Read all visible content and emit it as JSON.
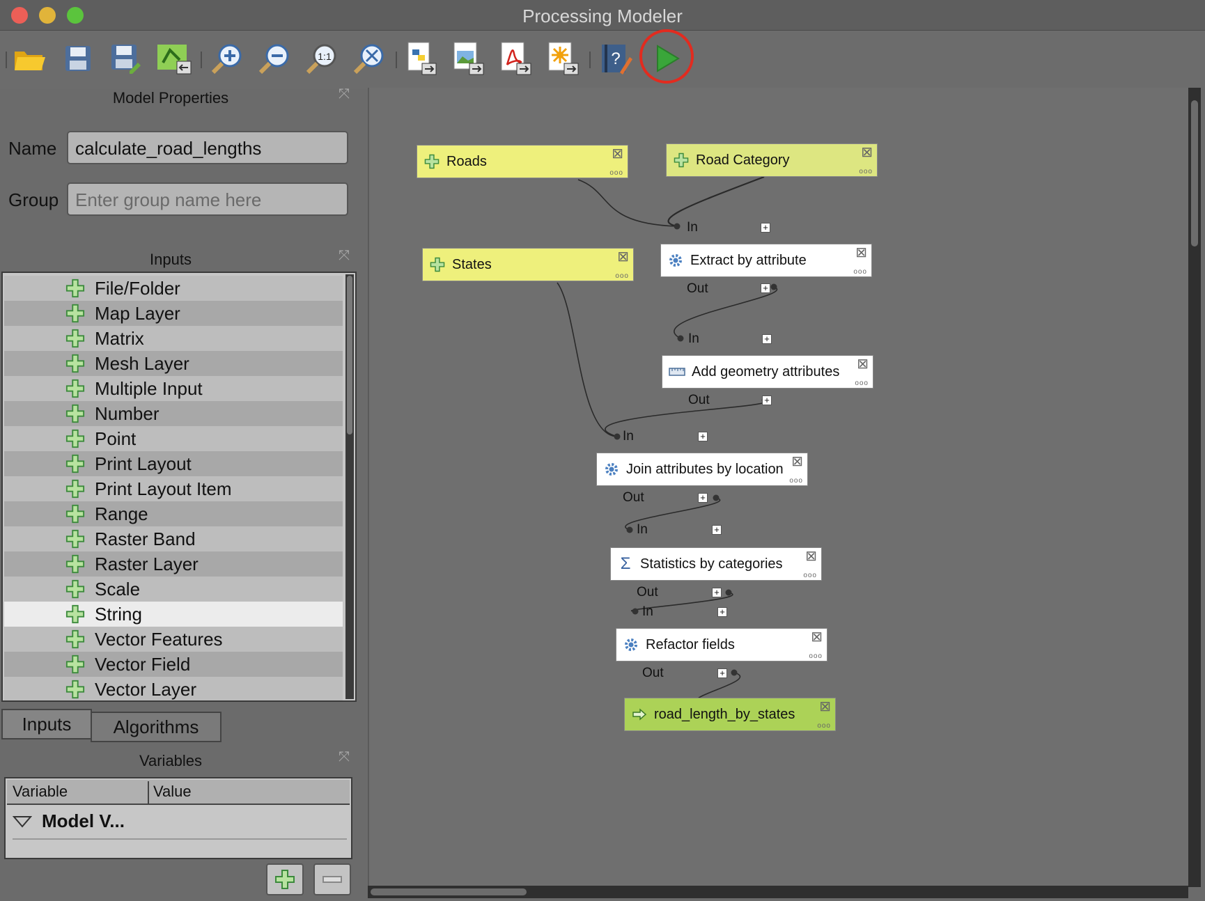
{
  "window": {
    "title": "Processing Modeler"
  },
  "toolbar": {
    "buttons": [
      {
        "name": "open-model-button",
        "icon": "folder-icon"
      },
      {
        "name": "save-model-button",
        "icon": "save-icon"
      },
      {
        "name": "save-as-button",
        "icon": "save-as-icon"
      },
      {
        "name": "save-in-project-button",
        "icon": "save-to-project-icon"
      },
      {
        "name": "zoom-in-button",
        "icon": "zoom-in-icon"
      },
      {
        "name": "zoom-out-button",
        "icon": "zoom-out-icon"
      },
      {
        "name": "zoom-actual-button",
        "icon": "zoom-actual-icon",
        "label": "1:1"
      },
      {
        "name": "zoom-full-button",
        "icon": "zoom-full-icon"
      },
      {
        "name": "export-python-button",
        "icon": "python-export-icon"
      },
      {
        "name": "export-image-button",
        "icon": "image-export-icon"
      },
      {
        "name": "export-pdf-button",
        "icon": "pdf-export-icon"
      },
      {
        "name": "export-svg-button",
        "icon": "svg-export-icon"
      },
      {
        "name": "edit-help-button",
        "icon": "help-edit-icon"
      },
      {
        "name": "run-model-button",
        "icon": "run-icon"
      }
    ],
    "highlight_color": "#e22b1f"
  },
  "model_properties": {
    "title": "Model Properties",
    "name_label": "Name",
    "name_value": "calculate_road_lengths",
    "group_label": "Group",
    "group_placeholder": "Enter group name here"
  },
  "inputs_panel": {
    "title": "Inputs",
    "items": [
      {
        "label": "File/Folder"
      },
      {
        "label": "Map Layer"
      },
      {
        "label": "Matrix"
      },
      {
        "label": "Mesh Layer"
      },
      {
        "label": "Multiple Input"
      },
      {
        "label": "Number"
      },
      {
        "label": "Point"
      },
      {
        "label": "Print Layout"
      },
      {
        "label": "Print Layout Item"
      },
      {
        "label": "Range"
      },
      {
        "label": "Raster Band"
      },
      {
        "label": "Raster Layer"
      },
      {
        "label": "Scale"
      },
      {
        "label": "String",
        "selected": true
      },
      {
        "label": "Vector Features"
      },
      {
        "label": "Vector Field"
      },
      {
        "label": "Vector Layer"
      }
    ]
  },
  "tabs": [
    {
      "label": "Inputs",
      "active": true
    },
    {
      "label": "Algorithms",
      "active": false
    }
  ],
  "variables": {
    "title": "Variables",
    "col_variable": "Variable",
    "col_value": "Value",
    "group_row": "Model V..."
  },
  "canvas": {
    "nodes": {
      "roads": {
        "label": "Roads",
        "kind": "input"
      },
      "road_category": {
        "label": "Road Category",
        "kind": "input"
      },
      "states": {
        "label": "States",
        "kind": "input"
      },
      "extract": {
        "label": "Extract by attribute",
        "kind": "algorithm",
        "icon": "gear-icon"
      },
      "add_geom": {
        "label": "Add geometry attributes",
        "kind": "algorithm",
        "icon": "ruler-icon"
      },
      "join": {
        "label": "Join attributes by location",
        "kind": "algorithm",
        "icon": "gear-icon"
      },
      "stats": {
        "label": "Statistics by categories",
        "kind": "algorithm",
        "icon": "sigma-icon"
      },
      "refactor": {
        "label": "Refactor fields",
        "kind": "algorithm",
        "icon": "gear-icon"
      },
      "output": {
        "label": "road_length_by_states",
        "kind": "output",
        "icon": "arrow-right-icon"
      }
    },
    "port_in": "In",
    "port_out": "Out",
    "colors": {
      "input": "#eef07c",
      "algorithm": "#ffffff",
      "output": "#acd257"
    }
  }
}
